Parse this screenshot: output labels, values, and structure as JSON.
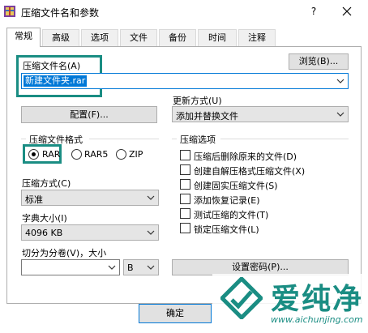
{
  "window": {
    "title": "压缩文件名和参数",
    "help_label": "?"
  },
  "tabs": [
    {
      "label": "常规"
    },
    {
      "label": "高级"
    },
    {
      "label": "选项"
    },
    {
      "label": "文件"
    },
    {
      "label": "备份"
    },
    {
      "label": "时间"
    },
    {
      "label": "注释"
    }
  ],
  "archive_name": {
    "label": "压缩文件名(A)",
    "value": "新建文件夹.rar",
    "browse_label": "浏览(B)..."
  },
  "update_mode": {
    "label": "更新方式(U)",
    "value": "添加并替换文件"
  },
  "profile_button": "配置(F)...",
  "format": {
    "label": "压缩文件格式",
    "options": [
      "RAR",
      "RAR5",
      "ZIP"
    ],
    "selected": "RAR"
  },
  "compression_method": {
    "label": "压缩方式(C)",
    "value": "标准"
  },
  "dictionary_size": {
    "label": "字典大小(I)",
    "value": "4096 KB"
  },
  "split_volumes": {
    "label": "切分为分卷(V)，大小",
    "unit_value": "B"
  },
  "options": {
    "label": "压缩选项",
    "items": [
      "压缩后删除原来的文件(D)",
      "创建自解压格式压缩文件(X)",
      "创建固实压缩文件(S)",
      "添加恢复记录(E)",
      "测试压缩的文件(T)",
      "锁定压缩文件(L)"
    ]
  },
  "password_button": "设置密码(P)...",
  "ok_button": "确定",
  "watermark": {
    "text": "爱纯净",
    "url": "www.aichunjing.com"
  },
  "colors": {
    "accent": "#0078d7",
    "highlight": "#1a8d83"
  }
}
